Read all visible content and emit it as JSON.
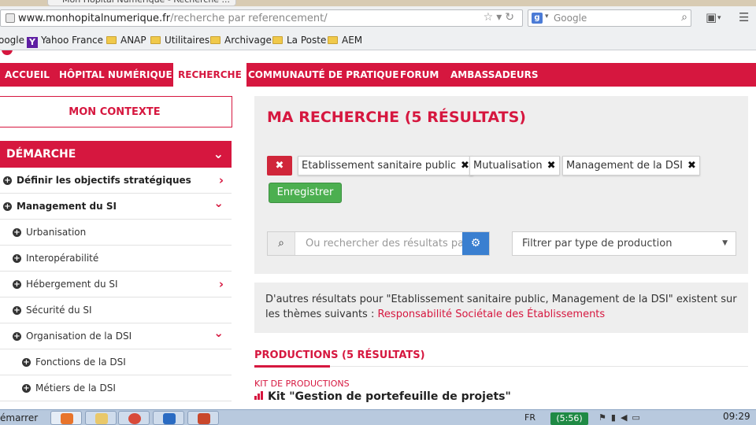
{
  "browser": {
    "tab_title": "Mon Hôpital Numérique - Recherche ...",
    "url_host": "www.monhopitalnumerique.fr",
    "url_path": "/recherche par referencement/",
    "search_placeholder": "Google",
    "bookmarks": [
      {
        "label": "oogle",
        "icon": "none"
      },
      {
        "label": "Yahoo France",
        "icon": "yahoo-icon"
      },
      {
        "label": "ANAP",
        "icon": "folder-icon"
      },
      {
        "label": "Utilitaires",
        "icon": "folder-icon"
      },
      {
        "label": "Archivage",
        "icon": "folder-icon"
      },
      {
        "label": "La Poste",
        "icon": "folder-icon"
      },
      {
        "label": "AEM",
        "icon": "folder-icon"
      }
    ]
  },
  "nav": {
    "items": [
      "ACCUEIL",
      "HÔPITAL NUMÉRIQUE",
      "RECHERCHE",
      "COMMUNAUTÉ DE PRATIQUE",
      "FORUM",
      "AMBASSADEURS"
    ],
    "active": "RECHERCHE"
  },
  "sidebar": {
    "context_label": "MON CONTEXTE",
    "demarche_label": "DÉMARCHE",
    "items": [
      {
        "label": "Définir les objectifs stratégiques",
        "level": 0,
        "bold": true,
        "arrow": "›"
      },
      {
        "label": "Management du SI",
        "level": 0,
        "bold": true,
        "arrow": "⌄"
      },
      {
        "label": "Urbanisation",
        "level": 1,
        "bold": false,
        "arrow": ""
      },
      {
        "label": "Interopérabilité",
        "level": 1,
        "bold": false,
        "arrow": ""
      },
      {
        "label": "Hébergement du SI",
        "level": 1,
        "bold": false,
        "arrow": "›"
      },
      {
        "label": "Sécurité du SI",
        "level": 1,
        "bold": false,
        "arrow": ""
      },
      {
        "label": "Organisation de la DSI",
        "level": 1,
        "bold": false,
        "arrow": "⌄"
      },
      {
        "label": "Fonctions de la DSI",
        "level": 2,
        "bold": false,
        "arrow": ""
      },
      {
        "label": "Métiers de la DSI",
        "level": 2,
        "bold": false,
        "arrow": ""
      }
    ]
  },
  "search": {
    "title": "MA RECHERCHE (5 RÉSULTATS)",
    "clear_symbol": "✖",
    "chips": [
      "Etablissement sanitaire public",
      "Mutualisation",
      "Management de la DSI"
    ],
    "chip_remove_symbol": "✖",
    "save_label": "Enregistrer",
    "input_placeholder": "Ou rechercher des résultats pa",
    "filter_label": "Filtrer par type de production"
  },
  "other_results": {
    "text": "D'autres résultats pour \"Etablissement sanitaire public, Management de la DSI\" existent sur les thèmes suivants : ",
    "link": "Responsabilité Sociétale des Établissements"
  },
  "productions": {
    "heading": "PRODUCTIONS (5 RÉSULTATS)",
    "kit_label": "KIT DE PRODUCTIONS",
    "kit_title": "Kit \"Gestion de portefeuille de projets\""
  },
  "taskbar": {
    "start_text": "émarrer",
    "lang": "FR",
    "badge": "(5:56)",
    "time": "09:29"
  },
  "colors": {
    "brand_red": "#d6173f",
    "save_green": "#4caf50",
    "gear_blue": "#3a7fd0"
  }
}
